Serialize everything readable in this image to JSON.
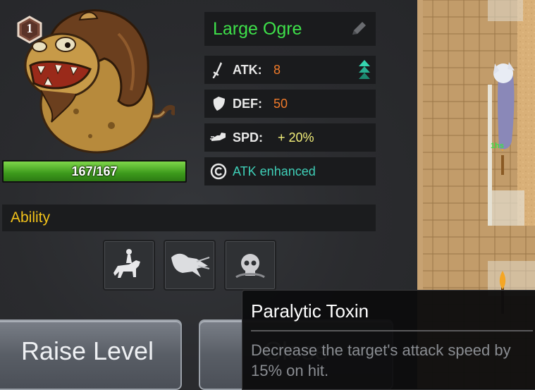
{
  "monster": {
    "level": "1",
    "name": "Large Ogre",
    "hp": "167/167",
    "hp_fraction": 1.0
  },
  "stats": {
    "atk_label": "ATK:",
    "atk_value": "8",
    "def_label": "DEF:",
    "def_value": "50",
    "spd_label": "SPD:",
    "spd_value": "+ 20%",
    "buff_text": "ATK enhanced"
  },
  "ability": {
    "title": "Ability",
    "icons": [
      "cavalry-rider-icon",
      "dragon-breath-icon",
      "poison-skull-icon"
    ]
  },
  "buttons": {
    "raise_level": "Raise Level",
    "close": "Close"
  },
  "tooltip": {
    "title": "Paralytic Toxin",
    "description": "Decrease the target's attack speed by 15% on hit."
  },
  "map": {
    "unit_label": "1hs"
  },
  "colors": {
    "name_green": "#3ee04a",
    "value_orange": "#f07a2a",
    "spd_value": "#f4f07a",
    "buff_teal": "#3fd0b8",
    "ability_gold": "#f2c21a",
    "hp_green": "#46a824"
  }
}
